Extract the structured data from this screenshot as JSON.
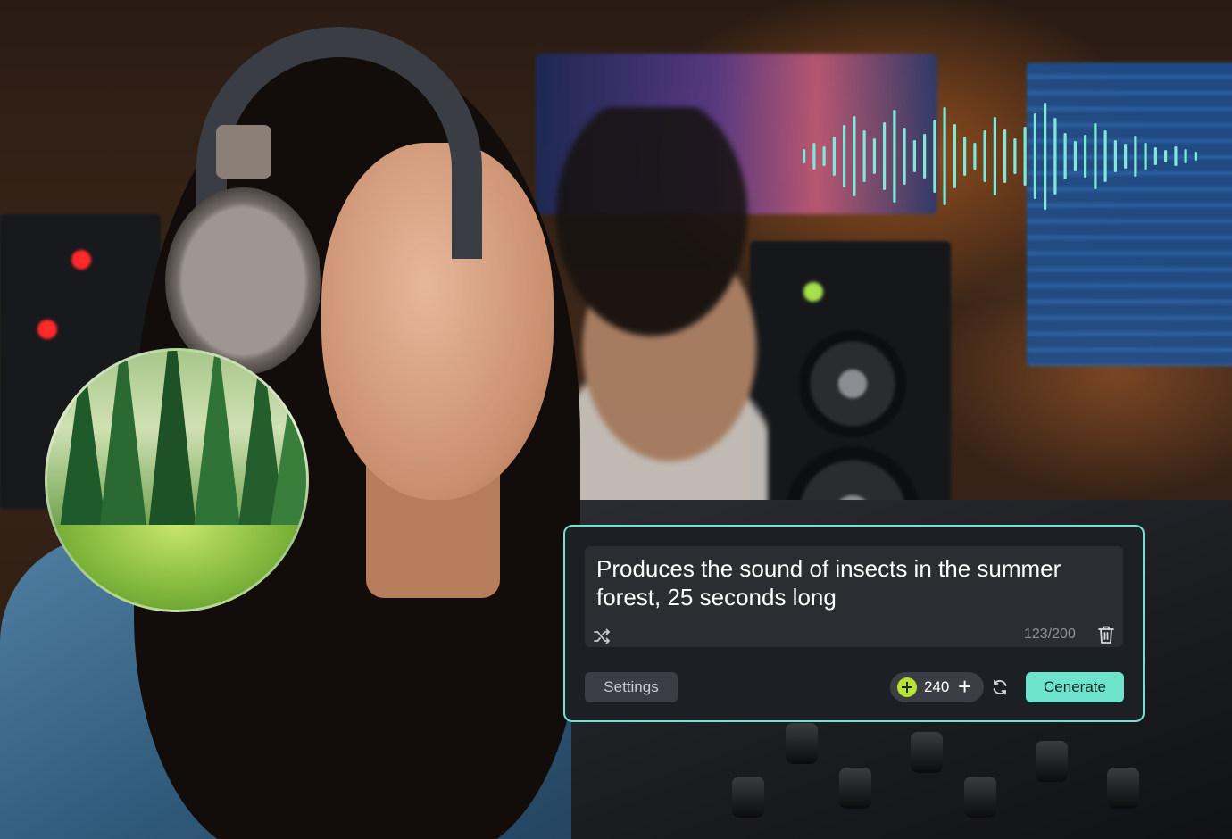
{
  "prompt": {
    "text": "Produces the sound of insects in the summer forest, 25 seconds long",
    "char_counter": "123/200"
  },
  "toolbar": {
    "settings_label": "Settings",
    "credits_value": "240",
    "credits_add_symbol": "+",
    "generate_label": "Cenerate"
  },
  "icons": {
    "shuffle": "shuffle-icon",
    "trash": "trash-icon",
    "credit": "credit-coin-icon",
    "refresh": "refresh-icon"
  },
  "colors": {
    "accent": "#6de3cc",
    "panel_border": "#6fe3cf",
    "panel_bg": "#1c1f23",
    "credit_icon": "#b8e234",
    "waveform": "#7fe8d8"
  }
}
